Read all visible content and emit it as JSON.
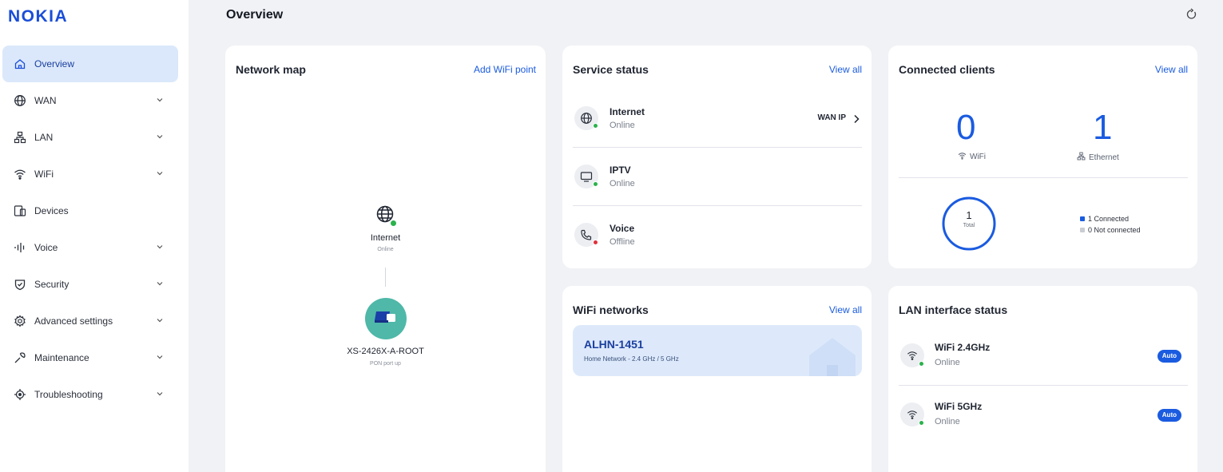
{
  "brand": {
    "logo_text": "NOKIA",
    "accent": "#1a5be0"
  },
  "header": {
    "title": "Overview",
    "refresh_icon": "refresh-icon"
  },
  "sidebar": {
    "items": [
      {
        "label": "Overview",
        "icon": "home-icon",
        "active": true,
        "has_chevron": false
      },
      {
        "label": "WAN",
        "icon": "globe-icon",
        "has_chevron": true
      },
      {
        "label": "LAN",
        "icon": "network-icon",
        "has_chevron": true
      },
      {
        "label": "WiFi",
        "icon": "wifi-icon",
        "has_chevron": true
      },
      {
        "label": "Devices",
        "icon": "devices-icon",
        "has_chevron": false
      },
      {
        "label": "Voice",
        "icon": "voice-icon",
        "has_chevron": true
      },
      {
        "label": "Security",
        "icon": "shield-icon",
        "has_chevron": true
      },
      {
        "label": "Advanced settings",
        "icon": "gear-icon",
        "has_chevron": true
      },
      {
        "label": "Maintenance",
        "icon": "wrench-icon",
        "has_chevron": true
      },
      {
        "label": "Troubleshooting",
        "icon": "target-icon",
        "has_chevron": true
      }
    ]
  },
  "network_map": {
    "title": "Network map",
    "action": "Add WiFi point",
    "internet": {
      "label": "Internet",
      "status": "Online"
    },
    "router": {
      "label": "XS-2426X-A-ROOT",
      "status": "PON port up"
    }
  },
  "service_status": {
    "title": "Service status",
    "action": "View all",
    "rows": [
      {
        "name": "Internet",
        "status": "Online",
        "state": "ok",
        "extra": "WAN IP"
      },
      {
        "name": "IPTV",
        "status": "Online",
        "state": "ok"
      },
      {
        "name": "Voice",
        "status": "Offline",
        "state": "error"
      }
    ]
  },
  "connected_clients": {
    "title": "Connected clients",
    "action": "View all",
    "wifi": {
      "count": "0",
      "label": "WiFi"
    },
    "ethernet": {
      "count": "1",
      "label": "Ethernet"
    },
    "total": {
      "count": "1",
      "label": "Total"
    },
    "legend": [
      {
        "label": "1 Connected",
        "color": "#1a5be0"
      },
      {
        "label": "0 Not connected",
        "color": "#c9ccd3"
      }
    ]
  },
  "wifi_networks": {
    "title": "WiFi networks",
    "action": "View all",
    "network": {
      "name": "ALHN-1451",
      "description": "Home Network - 2.4 GHz / 5 GHz"
    }
  },
  "lan_status": {
    "title": "LAN interface status",
    "rows": [
      {
        "name": "WiFi 2.4GHz",
        "status": "Online",
        "badge": "Auto"
      },
      {
        "name": "WiFi 5GHz",
        "status": "Online",
        "badge": "Auto"
      }
    ]
  },
  "colors": {
    "online": "#2bb24c",
    "offline": "#e0303a",
    "router": "#4fb8a8"
  }
}
